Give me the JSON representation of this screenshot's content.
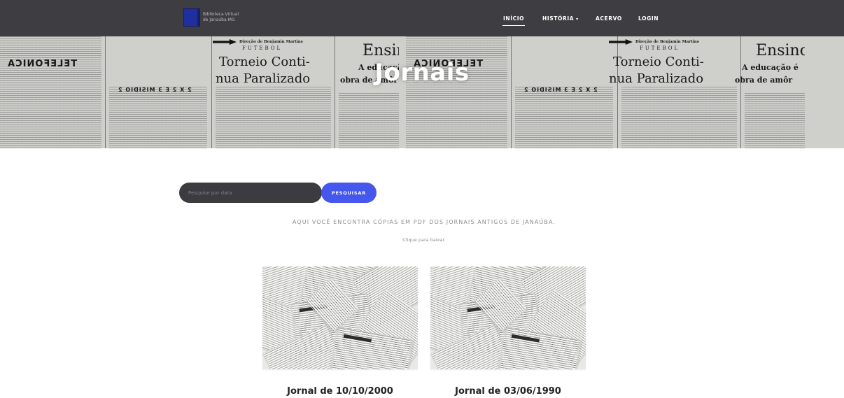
{
  "brand": {
    "name_line1": "Biblioteca Virtual",
    "name_line2": "de Janaúba-MG"
  },
  "nav": {
    "items": [
      {
        "label": "INÍCIO",
        "active": true
      },
      {
        "label": "HISTÓRIA",
        "dropdown": true,
        "caret": "▾"
      },
      {
        "label": "ACERVO"
      },
      {
        "label": "LOGIN"
      }
    ]
  },
  "hero": {
    "title": "Jornais",
    "clip_text": {
      "direction": "Direção de Benjamin Martins",
      "section": "FUTEBOL",
      "headline_1": "Torneio Conti-",
      "headline_2": "nua Paralizado",
      "headline_3": "Ensino",
      "headline_4": "A educação é",
      "headline_5": "obra de amôr",
      "mirror_1": "TELEFONICA",
      "mirror_2": "2 X 2 E 3 MISIDIO 2"
    }
  },
  "search": {
    "placeholder": "Pesquise por data",
    "button_label": "PESQUISAR"
  },
  "intro": {
    "text": "AQUI VOCÊ ENCONTRA CÓPIAS EM PDF DOS JORNAIS ANTIGOS DE JANAÚBA.",
    "hint": "Clique para baixar."
  },
  "newspapers": [
    {
      "title": "Jornal de 10/10/2000",
      "icon": "newspaper-thumbnail-icon"
    },
    {
      "title": "Jornal de 03/06/1990",
      "icon": "newspaper-thumbnail-icon"
    }
  ],
  "colors": {
    "navbar_bg": "#3e3e42",
    "accent": "#4657ee",
    "search_bg": "#3c3c40",
    "muted_text": "#8a8f96"
  }
}
